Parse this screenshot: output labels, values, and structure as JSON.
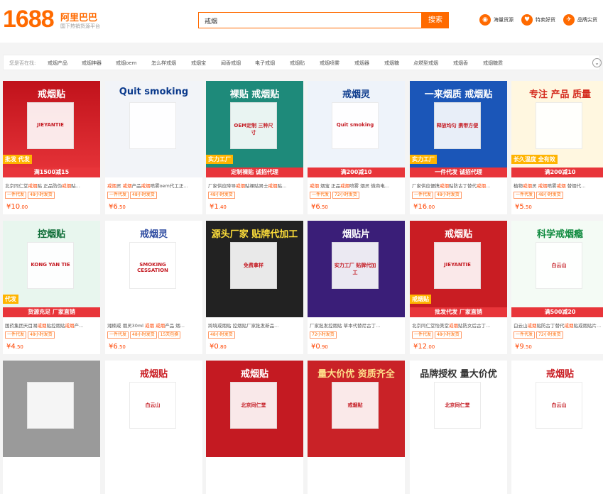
{
  "header": {
    "logo_number": "1688",
    "logo_text": "阿里巴巴",
    "logo_sub": "国下热销货源平台",
    "search_value": "戒烟",
    "search_button": "搜索",
    "links": [
      {
        "icon": "haikuo-icon",
        "label": "海量货源"
      },
      {
        "icon": "tejia-icon",
        "label": "特卖好货"
      },
      {
        "icon": "pinpai-icon",
        "label": "品牌尖货"
      }
    ]
  },
  "category_bar": {
    "prefix": "您是否在找:",
    "items": [
      "戒烟产品",
      "戒烟神器",
      "戒烟oem",
      "怎么样戒烟",
      "戒烟宝",
      "闻香戒烟",
      "电子戒烟",
      "戒烟贴",
      "戒烟喷雾",
      "戒烟器",
      "戒烟糖",
      "点燃型戒烟",
      "戒烟香",
      "戒烟糖质"
    ]
  },
  "products": [
    {
      "title": [
        "北京同仁堂",
        "戒烟",
        "贴 正品防伪",
        "戒烟",
        "贴..."
      ],
      "tags": [
        "一件代发",
        "48小时发货"
      ],
      "price_int": "¥10",
      "price_dec": ".00",
      "img_text": "戒烟贴",
      "img_sub": "JIEYANTIE",
      "badge": "满1500减15",
      "corner": "批发 代发",
      "theme": "red"
    },
    {
      "title": [
        "戒烟",
        "灵 ",
        "戒烟",
        "产品",
        "戒烟",
        "喷雾oem代工正..."
      ],
      "tags": [
        "一件代发",
        "48小时发货"
      ],
      "price_int": "¥6",
      "price_dec": ".50",
      "img_text": "Quit smoking",
      "img_sub": "",
      "badge": "",
      "corner": "",
      "theme": "blue"
    },
    {
      "title": [
        "厂家供应降导",
        "戒烟",
        "贴裸贴男士",
        "戒烟",
        "贴..."
      ],
      "tags": [
        "48小时发货"
      ],
      "price_int": "¥1",
      "price_dec": ".40",
      "img_text": "裸贴 戒烟贴",
      "img_sub": "OEM定制 三种尺寸",
      "badge": "定制裸贴 诚招代理",
      "corner": "实力工厂",
      "theme": "teal"
    },
    {
      "title": [
        "戒烟",
        " 烟宝 正品",
        "戒烟",
        "喷雾 烟灵 微商电..."
      ],
      "tags": [
        "一件代发",
        "72小时发货"
      ],
      "price_int": "¥6",
      "price_dec": ".50",
      "img_text": "戒烟灵",
      "img_sub": "Quit smoking",
      "badge": "满200减10",
      "corner": "",
      "theme": "bluewhite"
    },
    {
      "title": [
        "厂家供应便携",
        "戒烟",
        "贴防古丁替代",
        "戒烟",
        "..."
      ],
      "tags": [
        "一件代发",
        "48小时发货"
      ],
      "price_int": "¥16",
      "price_dec": ".00",
      "img_text": "一来烟质 戒烟贴",
      "img_sub": "释放均匀 携带方便",
      "badge": "一件代发 诚招代理",
      "corner": "实力工厂",
      "theme": "bluered"
    },
    {
      "title": [
        "植物",
        "戒烟",
        "灵 ",
        "戒烟",
        "喷雾",
        "戒烟",
        " 替烟代..."
      ],
      "tags": [
        "一件代发",
        "48小时发货"
      ],
      "price_int": "¥5",
      "price_dec": ".50",
      "img_text": "专注 产品 质量",
      "img_sub": "",
      "badge": "满200减10",
      "corner": "长久温度 全有效",
      "theme": "yellow"
    },
    {
      "title": [
        "国药集团天目湖",
        "戒烟",
        "贴控烟贴",
        "戒烟",
        "产..."
      ],
      "tags": [
        "一件代发",
        "48小时发货"
      ],
      "price_int": "¥4",
      "price_dec": ".50",
      "img_text": "控烟贴",
      "img_sub": "KONG YAN TIE",
      "badge": "货源充足 厂家直销",
      "corner": "代发",
      "theme": "green"
    },
    {
      "title": [
        "湘楠戒 烟灵30ml ",
        "戒烟",
        " ",
        "戒烟",
        "产品 烟..."
      ],
      "tags": [
        "一件代发",
        "48小时发货",
        "15天包换"
      ],
      "price_int": "¥6",
      "price_dec": ".50",
      "img_text": "戒烟灵",
      "img_sub": "SMOKING CESSATION",
      "badge": "",
      "corner": "",
      "theme": "white"
    },
    {
      "title": [
        "跨境戒烟贴 控烟贴厂家批发新品..."
      ],
      "tags": [
        "48小时发货"
      ],
      "price_int": "¥0",
      "price_dec": ".80",
      "img_text": "源头厂家 贴牌代加工",
      "img_sub": "免费拿样",
      "badge": "",
      "corner": "",
      "theme": "dark"
    },
    {
      "title": [
        "厂家批发控烟贴 草本代替尼古丁..."
      ],
      "tags": [
        "72小时发货"
      ],
      "price_int": "¥0",
      "price_dec": ".90",
      "img_text": "烟贴片",
      "img_sub": "实力工厂 贴牌代加工",
      "badge": "",
      "corner": "",
      "theme": "purple"
    },
    {
      "title": [
        "北京同仁堂怡美堂",
        "戒烟",
        "贴防女后古丁..."
      ],
      "tags": [
        "一件代发",
        "48小时发货"
      ],
      "price_int": "¥12",
      "price_dec": ".00",
      "img_text": "戒烟贴",
      "img_sub": "JIEYANTIE",
      "badge": "批发代发 厂家直销",
      "corner": "戒烟贴",
      "theme": "red2"
    },
    {
      "title": [
        "白云山",
        "戒烟",
        "贴防古丁替代",
        "戒烟",
        "贴戒烟贴片..."
      ],
      "tags": [
        "一件代发",
        "72小时发货"
      ],
      "price_int": "¥9",
      "price_dec": ".50",
      "img_text": "科学戒烟瘾",
      "img_sub": "白云山",
      "badge": "满500减20",
      "corner": "",
      "theme": "lightgreen"
    },
    {
      "title": [],
      "tags": [],
      "price_int": "",
      "price_dec": "",
      "img_text": "",
      "img_sub": "",
      "badge": "",
      "corner": "",
      "theme": "gray"
    },
    {
      "title": [],
      "tags": [],
      "price_int": "",
      "price_dec": "",
      "img_text": "戒烟贴",
      "img_sub": "白云山",
      "badge": "",
      "corner": "",
      "theme": "white2"
    },
    {
      "title": [],
      "tags": [],
      "price_int": "",
      "price_dec": "",
      "img_text": "戒烟贴",
      "img_sub": "北京同仁堂",
      "badge": "",
      "corner": "",
      "theme": "red3"
    },
    {
      "title": [],
      "tags": [],
      "price_int": "",
      "price_dec": "",
      "img_text": "量大价优 资质齐全",
      "img_sub": "戒烟贴",
      "badge": "",
      "corner": "",
      "theme": "red4"
    },
    {
      "title": [],
      "tags": [],
      "price_int": "",
      "price_dec": "",
      "img_text": "品牌授权 量大价优",
      "img_sub": "北京同仁堂",
      "badge": "",
      "corner": "",
      "theme": "red5"
    },
    {
      "title": [],
      "tags": [],
      "price_int": "",
      "price_dec": "",
      "img_text": "戒烟贴",
      "img_sub": "白云山",
      "badge": "",
      "corner": "",
      "theme": "white3"
    }
  ],
  "colors": {
    "accent": "#ff6a00",
    "price": "#ff4400"
  }
}
